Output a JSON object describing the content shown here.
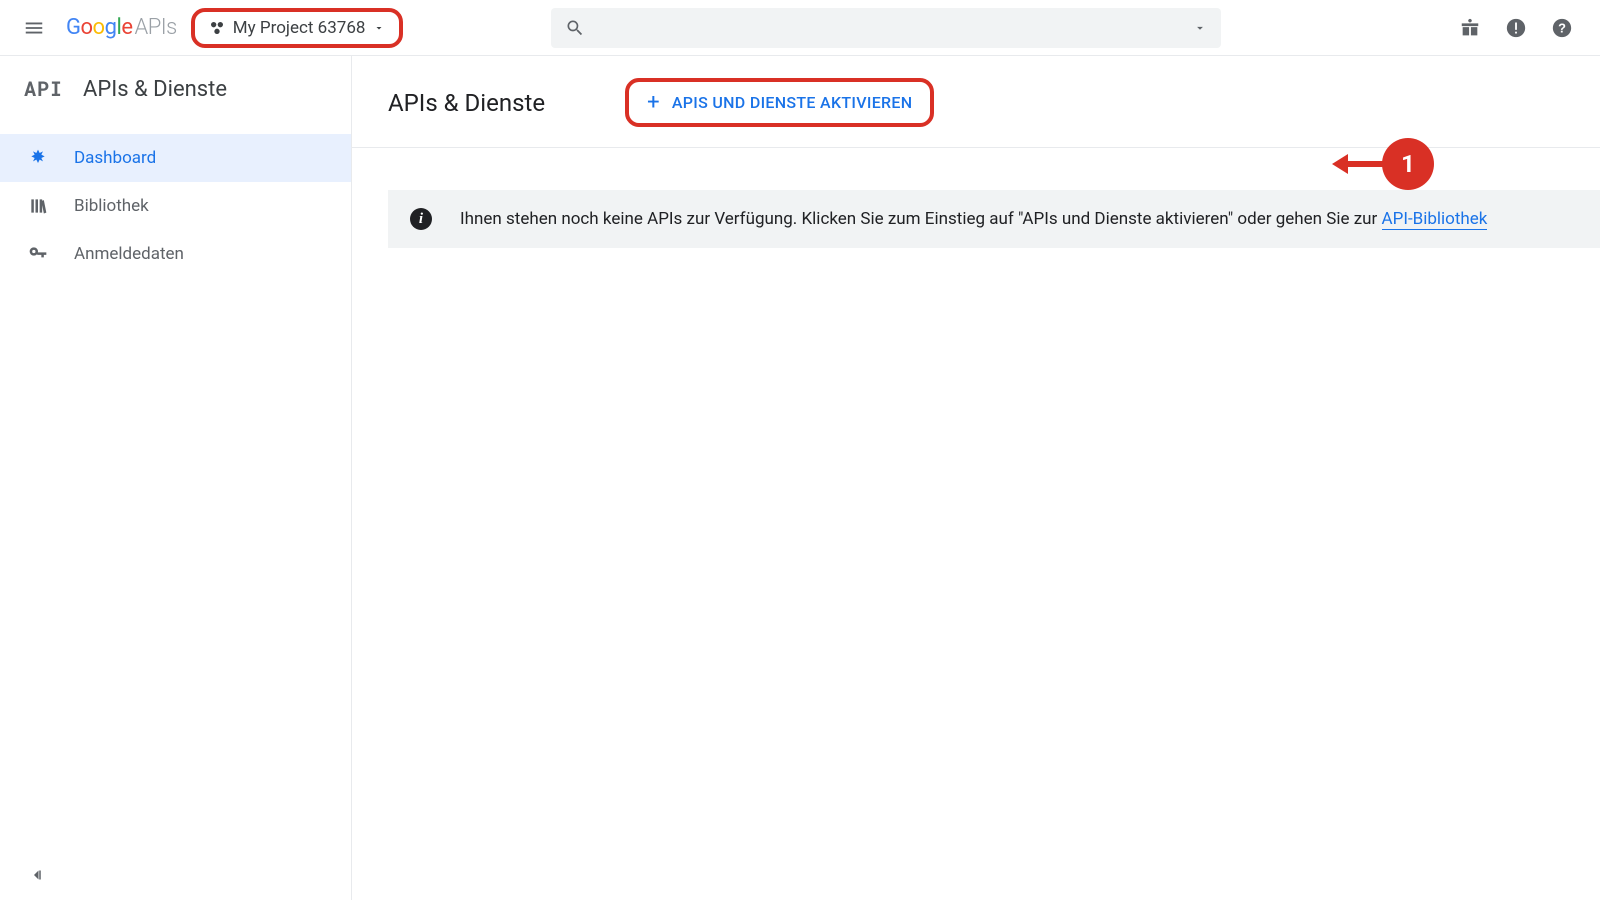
{
  "header": {
    "logo_prefix_chars": [
      "G",
      "o",
      "o",
      "g",
      "l",
      "e"
    ],
    "logo_suffix": " APIs",
    "project_name": "My Project 63768"
  },
  "sidebar": {
    "section_label": "APIs & Dienste",
    "items": [
      {
        "label": "Dashboard",
        "icon": "dashboard-icon",
        "active": true
      },
      {
        "label": "Bibliothek",
        "icon": "library-icon",
        "active": false
      },
      {
        "label": "Anmeldedaten",
        "icon": "credentials-icon",
        "active": false
      }
    ]
  },
  "main": {
    "title": "APIs & Dienste",
    "enable_button": "APIS UND DIENSTE AKTIVIEREN",
    "info_text": "Ihnen stehen noch keine APIs zur Verfügung. Klicken Sie zum Einstieg auf \"APIs und Dienste aktivieren\" oder gehen Sie zur ",
    "info_link": "API-Bibliothek"
  },
  "annotation": {
    "badge": "1"
  },
  "colors": {
    "accent": "#1a73e8",
    "highlight": "#d93025"
  }
}
